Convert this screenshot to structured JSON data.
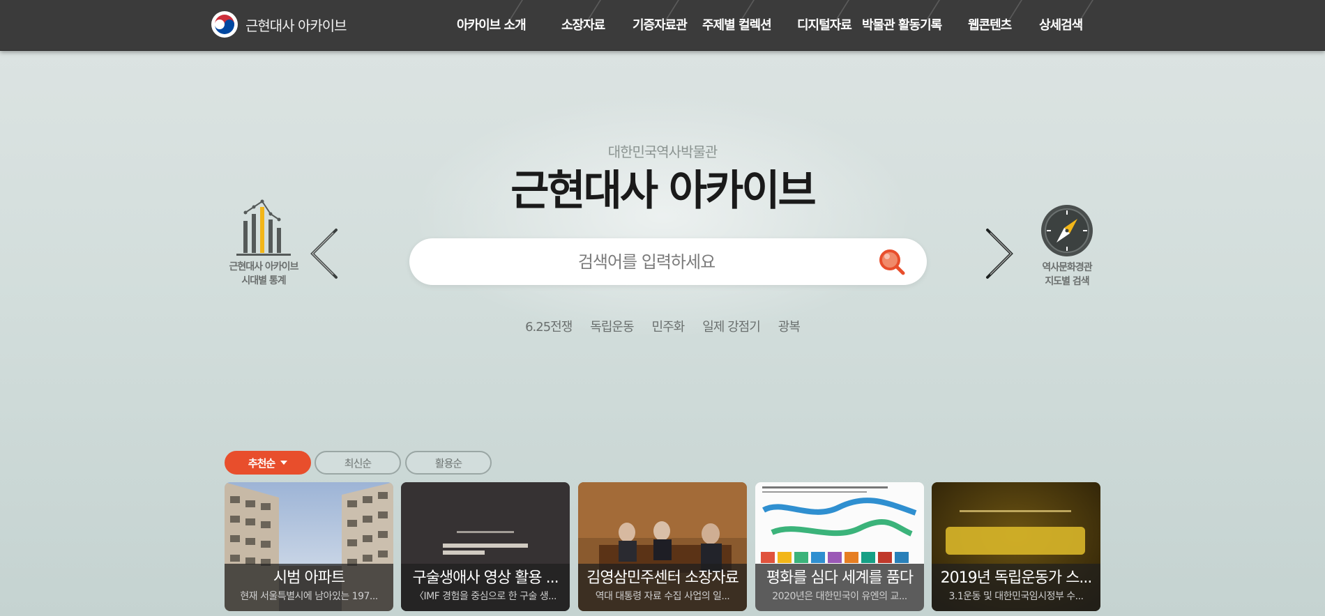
{
  "header": {
    "logo_text": "근현대사 아카이브",
    "nav": [
      {
        "label": "아카이브 소개"
      },
      {
        "label": "소장자료"
      },
      {
        "label": "기증자료관"
      },
      {
        "label": "주제별 컬렉션"
      },
      {
        "label": "디지털자료"
      },
      {
        "label": "박물관 활동기록"
      },
      {
        "label": "웹콘텐츠"
      },
      {
        "label": "상세검색"
      }
    ]
  },
  "hero": {
    "subtitle": "대한민국역사박물관",
    "title_bold": "근현대사",
    "title_light": " 아카이브"
  },
  "search": {
    "placeholder": "검색어를 입력하세요",
    "value": ""
  },
  "keywords": [
    "6.25전쟁",
    "독립운동",
    "민주화",
    "일제 강점기",
    "광복"
  ],
  "side_links": {
    "left": {
      "line1": "근현대사 아카이브",
      "line2": "시대별 통계",
      "icon": "bar-chart-icon"
    },
    "right": {
      "line1": "역사문화경관",
      "line2": "지도별 검색",
      "icon": "compass-icon"
    }
  },
  "sort": {
    "active": "추천순",
    "options": [
      "최신순",
      "활용순"
    ]
  },
  "cards": [
    {
      "title": "시범 아파트",
      "desc": "현재 서울특별시에 남아있는 197..."
    },
    {
      "title": "구술생애사 영상 활용 ...",
      "desc": "〈IMF 경험을 중심으로 한 구술 생..."
    },
    {
      "title": "김영삼민주센터 소장자료",
      "desc": "역대 대통령 자료 수집 사업의 일..."
    },
    {
      "title": "평화를 심다 세계를 품다",
      "desc": "2020년은 대한민국이 유엔의 교..."
    },
    {
      "title": "2019년 독립운동가 스...",
      "desc": "3.1운동 및 대한민국임시정부 수..."
    }
  ],
  "colors": {
    "accent": "#e84e2c",
    "topbar": "#3b3b3b",
    "background": "#d3dedc"
  }
}
